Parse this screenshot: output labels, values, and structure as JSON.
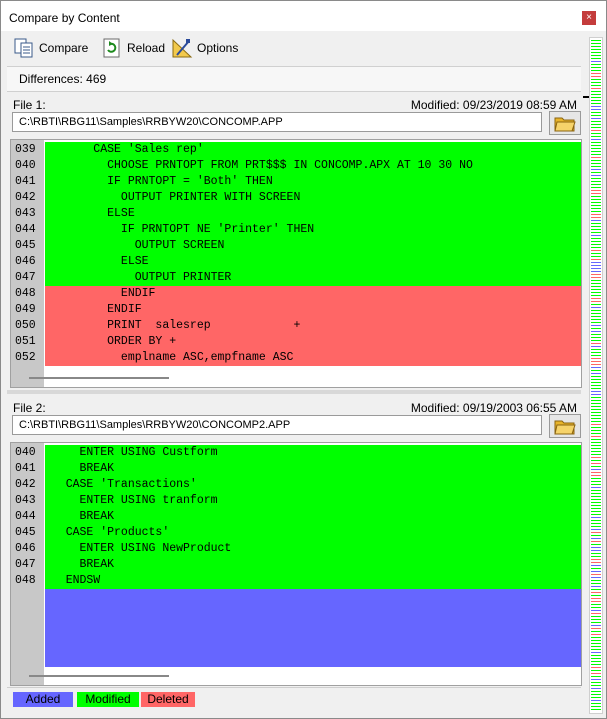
{
  "window": {
    "title": "Compare by Content"
  },
  "toolbar": {
    "compare": "Compare",
    "reload": "Reload",
    "options": "Options"
  },
  "differences_label": "Differences: 469",
  "file1": {
    "label": "File 1:",
    "modified": "Modified: 09/23/2019 08:59 AM",
    "path": "C:\\RBTI\\RBG11\\Samples\\RRBYW20\\CONCOMP.APP",
    "lines": [
      {
        "num": "039",
        "text": "       CASE 'Sales rep'",
        "state": "modified"
      },
      {
        "num": "040",
        "text": "         CHOOSE PRNTOPT FROM PRT$$$ IN CONCOMP.APX AT 10 30 NO",
        "state": "modified"
      },
      {
        "num": "041",
        "text": "         IF PRNTOPT = 'Both' THEN",
        "state": "modified"
      },
      {
        "num": "042",
        "text": "           OUTPUT PRINTER WITH SCREEN",
        "state": "modified"
      },
      {
        "num": "043",
        "text": "         ELSE",
        "state": "modified"
      },
      {
        "num": "044",
        "text": "           IF PRNTOPT NE 'Printer' THEN",
        "state": "modified"
      },
      {
        "num": "045",
        "text": "             OUTPUT SCREEN",
        "state": "modified"
      },
      {
        "num": "046",
        "text": "           ELSE",
        "state": "modified"
      },
      {
        "num": "047",
        "text": "             OUTPUT PRINTER",
        "state": "modified"
      },
      {
        "num": "048",
        "text": "           ENDIF",
        "state": "deleted"
      },
      {
        "num": "049",
        "text": "         ENDIF",
        "state": "deleted"
      },
      {
        "num": "050",
        "text": "         PRINT  salesrep            +",
        "state": "deleted"
      },
      {
        "num": "051",
        "text": "         ORDER BY +",
        "state": "deleted"
      },
      {
        "num": "052",
        "text": "           emplname ASC,empfname ASC",
        "state": "deleted"
      }
    ]
  },
  "file2": {
    "label": "File 2:",
    "modified": "Modified: 09/19/2003 06:55 AM",
    "path": "C:\\RBTI\\RBG11\\Samples\\RRBYW20\\CONCOMP2.APP",
    "lines": [
      {
        "num": "040",
        "text": "     ENTER USING Custform",
        "state": "modified"
      },
      {
        "num": "041",
        "text": "     BREAK",
        "state": "modified"
      },
      {
        "num": "042",
        "text": "   CASE 'Transactions'",
        "state": "modified"
      },
      {
        "num": "043",
        "text": "     ENTER USING tranform",
        "state": "modified"
      },
      {
        "num": "044",
        "text": "     BREAK",
        "state": "modified"
      },
      {
        "num": "045",
        "text": "   CASE 'Products'",
        "state": "modified"
      },
      {
        "num": "046",
        "text": "     ENTER USING NewProduct",
        "state": "modified"
      },
      {
        "num": "047",
        "text": "     BREAK",
        "state": "modified"
      },
      {
        "num": "048",
        "text": "   ENDSW",
        "state": "modified"
      }
    ]
  },
  "legend": {
    "added": "Added",
    "modified": "Modified",
    "deleted": "Deleted"
  },
  "colors": {
    "added": "#6666ff",
    "modified": "#00ff00",
    "deleted": "#ff6666"
  },
  "icons": {
    "compare": "compare-document-icon",
    "reload": "reload-icon",
    "options": "options-ruler-icon",
    "folder": "open-folder-icon"
  }
}
